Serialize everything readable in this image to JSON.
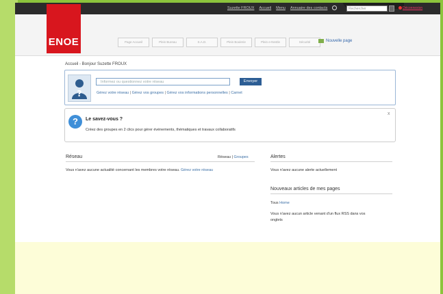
{
  "topbar": {
    "links": [
      "Suzette FROUX",
      "Accueil",
      "Menu",
      "Annuaire des contacts"
    ],
    "search_placeholder": "Rechercher",
    "logout": "Déconnexion"
  },
  "header": {
    "logo": "ENOE",
    "tabs": [
      "Page Accueil",
      "Plein Bureau",
      "S.A.D.",
      "Plein Boulerie",
      "Plein e-Nestle",
      "Sécurité"
    ],
    "new_page": "Nouvelle page"
  },
  "breadcrumb": "Accueil - Bonjour Suzette FROUX",
  "share": {
    "placeholder": "Informez ou questionnez votre réseau",
    "send": "Envoyer",
    "link1": "Gérez votre réseau",
    "link2": "Gérez vos groupes",
    "link3": "Gérez vos informations personnelles",
    "link4": "Carnet",
    "sep": "|"
  },
  "tip": {
    "icon": "?",
    "title": "Le savez-vous ?",
    "text": "Créez des groupes en 2 clics pour gérer événements, thématiques et travaux collaboratifs",
    "close": "x"
  },
  "reseau": {
    "title": "Réseau",
    "tab1": "Réseau",
    "sep": "|",
    "tab2": "Groupes",
    "message": "Vous n'avez aucune actualité concernant les membres votre réseau.",
    "link": "Gérez votre réseau"
  },
  "alertes": {
    "title": "Alertes",
    "message": "Vous n'avez aucune alerte actuellement"
  },
  "articles": {
    "title": "Nouveaux articles de mes pages",
    "filter_label": "Tous",
    "filter_link": "Home",
    "message_line1": "Vous n'avez aucun article venant d'un flux RSS dans vos",
    "message_line2": "onglets"
  }
}
